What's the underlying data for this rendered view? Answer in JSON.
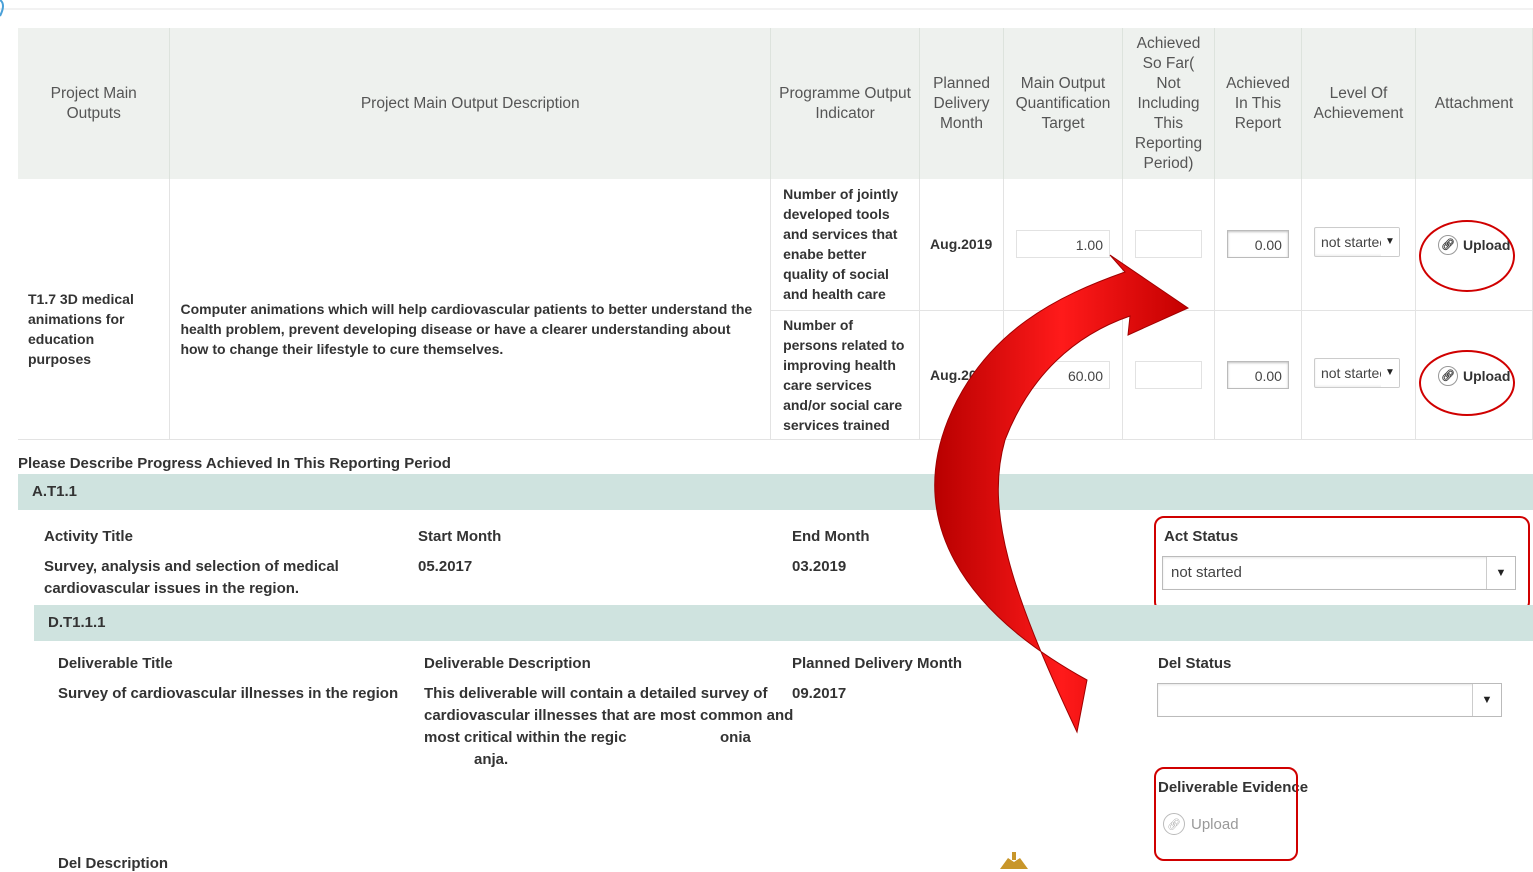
{
  "table": {
    "headers": {
      "main_outputs": "Project Main Outputs",
      "description": "Project Main Output Description",
      "indicator": "Programme Output Indicator",
      "planned_month": "Planned Delivery Month",
      "target": "Main Output Quantification Target",
      "achieved_so_far": "Achieved So Far( Not Including This Reporting Period)",
      "achieved_report": "Achieved In This Report",
      "level": "Level Of Achievement",
      "attachment": "Attachment"
    },
    "output": {
      "name": "T1.7 3D medical animations for education purposes",
      "description": "Computer animations which will help cardiovascular patients to better understand the health problem, prevent developing disease or have a clearer understanding about how to change their lifestyle to cure themselves."
    },
    "rows": [
      {
        "indicator": "Number of jointly developed tools and services that enabe better quality of social and health care",
        "month": "Aug.2019",
        "target": "1.00",
        "achieved_so_far": "",
        "achieved_report": "0.00",
        "level": "not startec",
        "upload": "Upload"
      },
      {
        "indicator": "Number of persons related to improving health care services and/or social care services trained",
        "month": "Aug.20",
        "target": "60.00",
        "achieved_so_far": "",
        "achieved_report": "0.00",
        "level": "not startec",
        "upload": "Upload"
      }
    ]
  },
  "progress": {
    "label": "Please Describe Progress Achieved In This Reporting Period",
    "activity": {
      "code": "A.T1.1",
      "title_label": "Activity Title",
      "title": "Survey, analysis and selection of medical cardiovascular issues in the region.",
      "start_label": "Start Month",
      "start": "05.2017",
      "end_label": "End Month",
      "end": "03.2019",
      "status_label": "Act Status",
      "status": "not started"
    },
    "deliverable": {
      "code": "D.T1.1.1",
      "title_label": "Deliverable Title",
      "title": "Survey of cardiovascular illnesses in the region",
      "desc_label": "Deliverable Description",
      "desc_line1": "This deliverable will contain a detailed survey of",
      "desc_line2": "cardiovascular illnesses that are most common and",
      "desc_line3": "most critical within the regic",
      "desc_line3b": "onia",
      "desc_line4": "anja.",
      "month_label": "Planned Delivery Month",
      "month": "09.2017",
      "status_label": "Del Status",
      "status": "",
      "evidence_label": "Deliverable Evidence",
      "evidence_upload": "Upload",
      "del_description_label": "Del Description"
    }
  },
  "colors": {
    "annotation": "#d00000",
    "arrow_red": "#e00000",
    "section_bar": "#cfe3df",
    "header_bg": "#eef1ee"
  },
  "icons": {
    "link": "link-icon",
    "dropdown": "chevron-down-icon",
    "arrow": "curved-arrow"
  }
}
